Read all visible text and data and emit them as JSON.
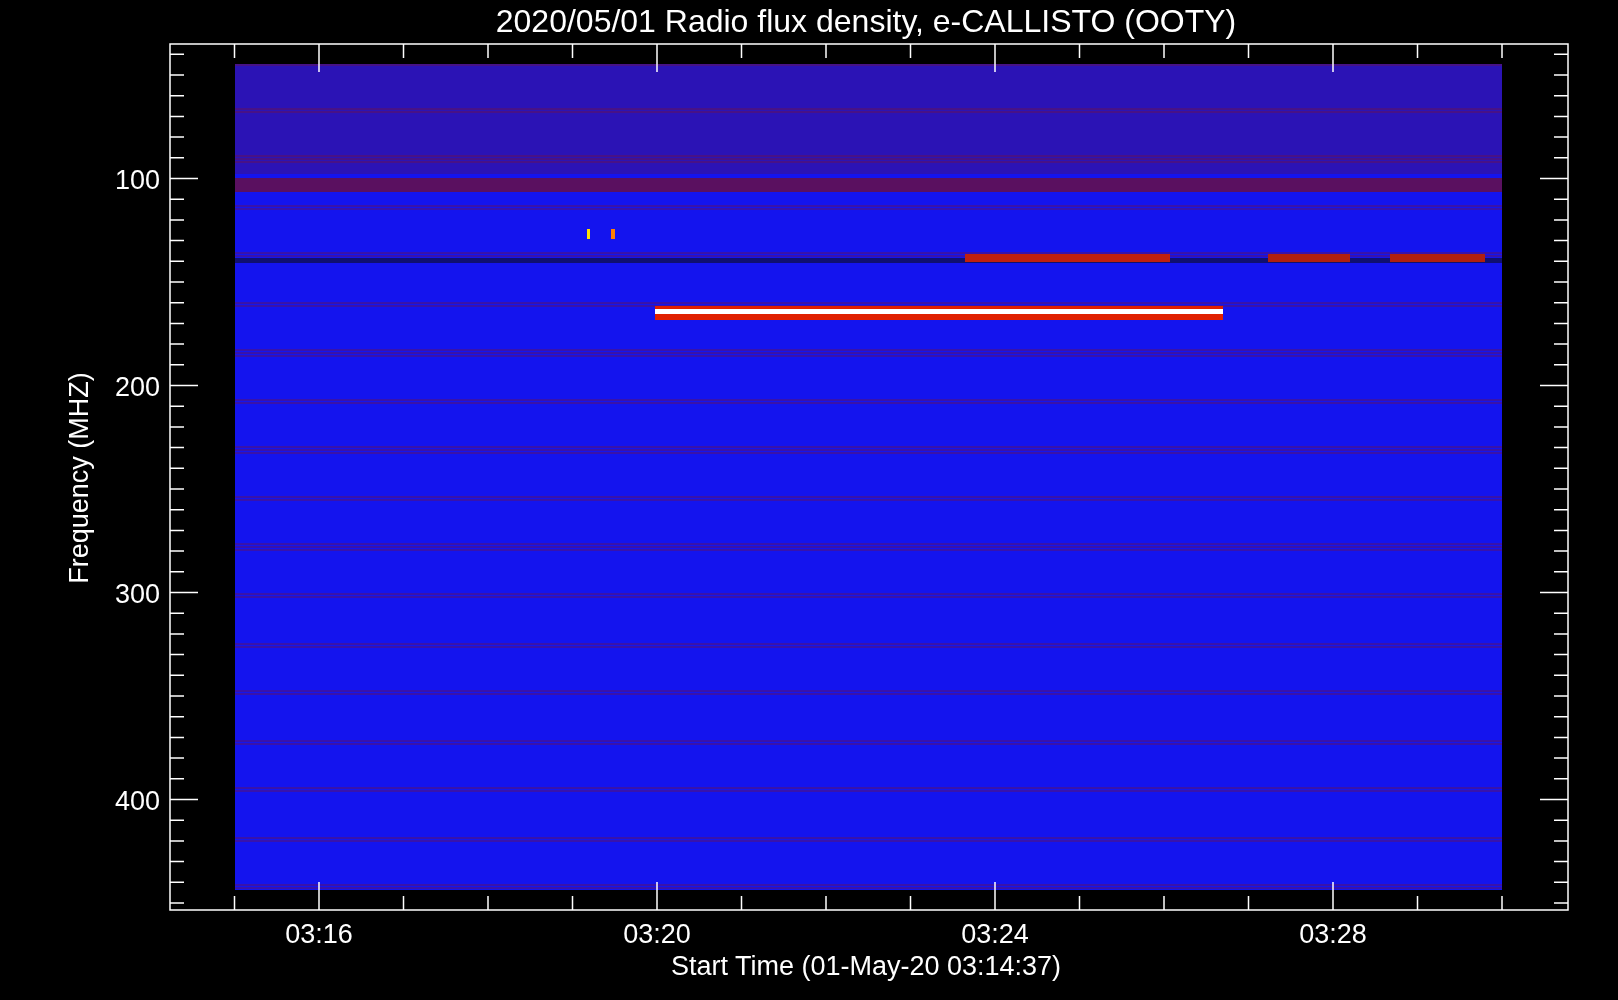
{
  "title": "2020/05/01  Radio flux density, e-CALLISTO (OOTY)",
  "axes": {
    "ylabel": "Frequency (MHZ)",
    "xlabel": "Start Time (01-May-20 03:14:37)",
    "y_tick_labels": [
      "100",
      "200",
      "300",
      "400"
    ],
    "x_tick_labels": [
      "03:16",
      "03:20",
      "03:24",
      "03:28"
    ]
  }
}
